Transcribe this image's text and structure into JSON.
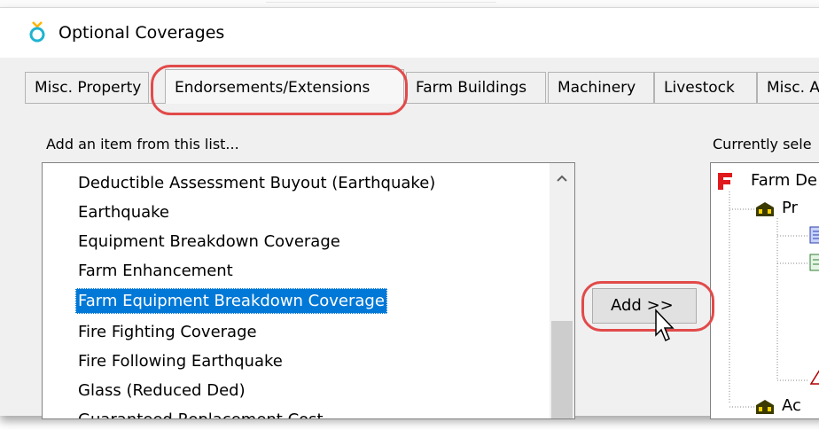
{
  "window": {
    "title": "Optional Coverages"
  },
  "tabs": [
    {
      "label": "Misc. Property",
      "active": false
    },
    {
      "label": "Endorsements/Extensions",
      "active": true
    },
    {
      "label": "Farm Buildings",
      "active": false
    },
    {
      "label": "Machinery",
      "active": false
    },
    {
      "label": "Livestock",
      "active": false
    },
    {
      "label": "Misc. A",
      "active": false
    }
  ],
  "available": {
    "label": "Add an item from this list...",
    "items": [
      "Deductible Assessment Buyout (Earthquake)",
      "Earthquake",
      "Equipment Breakdown Coverage",
      "Farm Enhancement",
      "Farm Equipment Breakdown Coverage",
      "Fire Fighting Coverage",
      "Fire Following Earthquake",
      "Glass (Reduced Ded)",
      "Guaranteed Replacement Cost"
    ],
    "selected_index": 4
  },
  "add_button": {
    "label": "Add >>"
  },
  "current": {
    "label": "Currently sele",
    "tree": {
      "root": "Farm De",
      "child1": "Pr",
      "child2": "Ac"
    }
  },
  "colors": {
    "highlight": "#e24a4a",
    "selection": "#0078d7"
  }
}
